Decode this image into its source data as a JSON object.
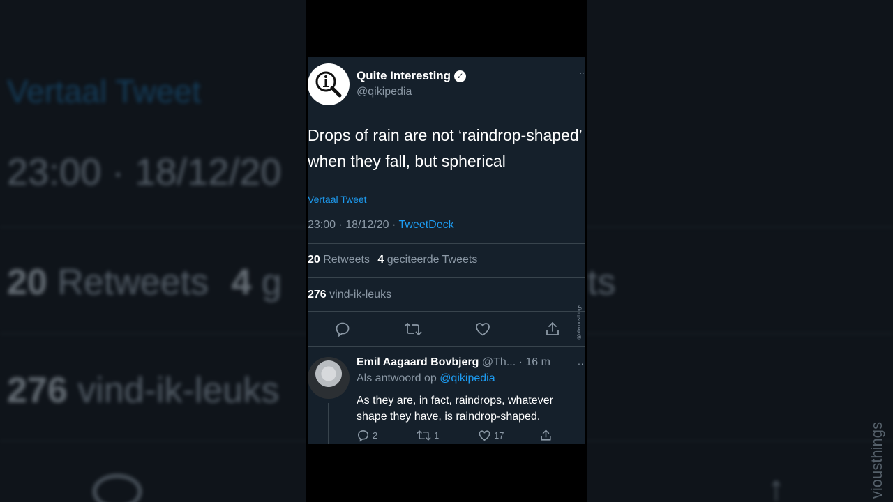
{
  "tweet": {
    "author_name": "Quite Interesting",
    "handle": "@qikipedia",
    "more_glyph": "··",
    "verified_glyph": "✓",
    "text": "Drops of rain are not ‘raindrop-shaped’ when they fall, but spherical",
    "translate_label": "Vertaal Tweet",
    "time": "23:00 · 18/12/20 · ",
    "source": "TweetDeck",
    "retweets_count": "20",
    "retweets_label": "Retweets",
    "quotes_count": "4",
    "quotes_label": "geciteerde Tweets",
    "likes_count": "276",
    "likes_label": "vind-ik-leuks"
  },
  "actions": {
    "icons": [
      "reply-icon",
      "retweet-icon",
      "like-icon",
      "share-icon"
    ]
  },
  "watermark": "@obviousthings",
  "reply": {
    "name": "Emil Aagaard Bovbjerg",
    "handle": "@Th...",
    "time": "· 16 m",
    "more_glyph": "··",
    "reply_to_label": "Als antwoord op",
    "reply_to_mention": "@qikipedia",
    "text": "As they are, in fact, raindrops, whatever shape they have, is raindrop-shaped.",
    "reply_count": "2",
    "retweet_count": "1",
    "like_count": "17"
  },
  "background": {
    "translate": "Vertaal Tweet",
    "time": "23:00 · 18/12/20",
    "retweets_count": "20",
    "retweets_label": "Retweets",
    "quotes_count": "4",
    "quotes_label": "g",
    "likes_count": "276",
    "likes_label": "vind-ik-leuks",
    "right_fragment": "ts",
    "watermark": "viousthings"
  },
  "colors": {
    "card_bg": "#15202b",
    "accent": "#1d9bf0",
    "muted": "#8b98a5",
    "divider": "#38444d"
  }
}
